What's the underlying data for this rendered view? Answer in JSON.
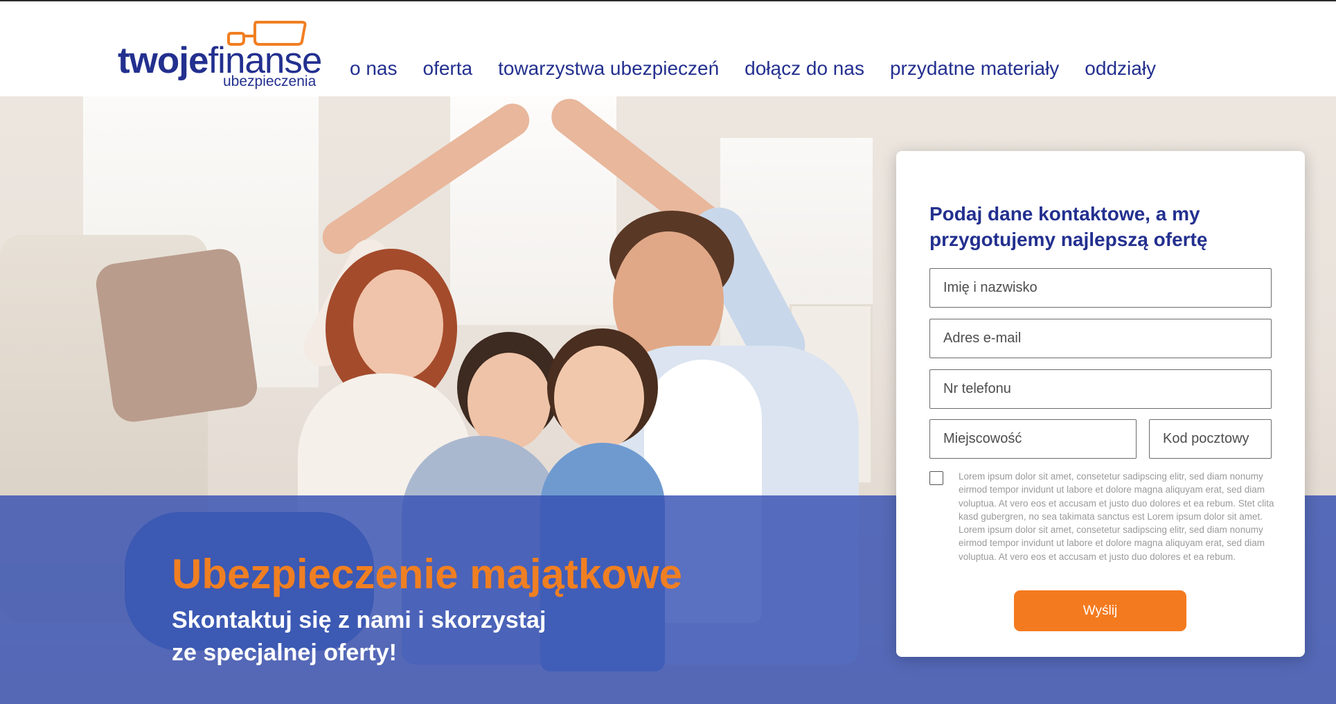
{
  "brand": {
    "logo_part1": "twoje",
    "logo_part2": "finanse",
    "logo_sub": "ubezpieczenia"
  },
  "nav": {
    "items": [
      {
        "label": "o nas"
      },
      {
        "label": "oferta"
      },
      {
        "label": "towarzystwa ubezpieczeń"
      },
      {
        "label": "dołącz do nas"
      },
      {
        "label": "przydatne materiały"
      },
      {
        "label": "oddziały"
      }
    ]
  },
  "hero": {
    "title": "Ubezpieczenie majątkowe",
    "subtitle_line1": "Skontaktuj się z nami i skorzystaj",
    "subtitle_line2": "ze specjalnej oferty!"
  },
  "form": {
    "title": "Podaj dane kontaktowe, a my przygotujemy najlepszą ofertę",
    "name_placeholder": "Imię i nazwisko",
    "email_placeholder": "Adres e-mail",
    "phone_placeholder": "Nr telefonu",
    "city_placeholder": "Miejscowość",
    "zip_placeholder": "Kod pocztowy",
    "consent_text": "Lorem ipsum dolor sit amet, consetetur sadipscing elitr, sed diam nonumy eirmod tempor invidunt ut labore et dolore magna aliquyam erat, sed diam voluptua. At vero eos et accusam et justo duo dolores et ea rebum. Stet clita kasd gubergren, no sea takimata sanctus est Lorem ipsum dolor sit amet. Lorem ipsum dolor sit amet, consetetur sadipscing elitr, sed diam nonumy eirmod tempor invidunt ut labore et dolore magna aliquyam erat, sed diam voluptua. At vero eos et accusam et justo duo dolores et ea rebum.",
    "consent_checked": false,
    "submit_label": "Wyślij"
  },
  "colors": {
    "brand_blue": "#23308f",
    "accent_orange": "#f47a1f",
    "band_blue": "#3650b2"
  }
}
